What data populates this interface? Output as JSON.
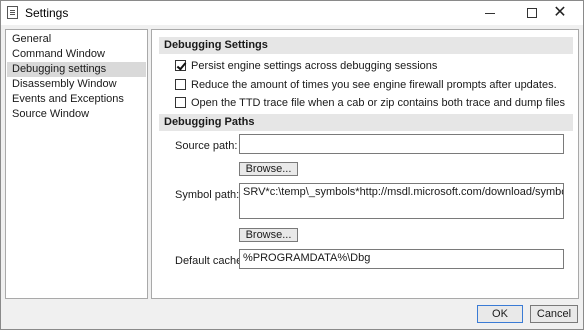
{
  "window": {
    "title": "Settings",
    "close_glyph": "✕",
    "icons": {
      "title": "document-icon",
      "minimize": "minimize-icon",
      "maximize": "maximize-icon",
      "close": "close-icon"
    }
  },
  "nav": {
    "items": [
      {
        "label": "General"
      },
      {
        "label": "Command Window"
      },
      {
        "label": "Debugging settings",
        "selected": true
      },
      {
        "label": "Disassembly Window"
      },
      {
        "label": "Events and Exceptions"
      },
      {
        "label": "Source Window"
      }
    ]
  },
  "debugging_settings": {
    "header": "Debugging Settings",
    "options": [
      {
        "label": "Persist engine settings across debugging sessions",
        "checked": true
      },
      {
        "label": "Reduce the amount of times you see engine firewall prompts after updates.",
        "checked": false
      },
      {
        "label": "Open the TTD trace file when a cab or zip contains both trace and dump files",
        "checked": false
      }
    ]
  },
  "debugging_paths": {
    "header": "Debugging Paths",
    "source_path": {
      "label": "Source path:",
      "value": "",
      "browse_label": "Browse..."
    },
    "symbol_path": {
      "label": "Symbol path:",
      "value": "SRV*c:\\temp\\_symbols*http://msdl.microsoft.com/download/symbols",
      "browse_label": "Browse..."
    },
    "default_cache": {
      "label": "Default cache:",
      "value": "%PROGRAMDATA%\\Dbg"
    }
  },
  "footer": {
    "ok_label": "OK",
    "cancel_label": "Cancel"
  },
  "colors": {
    "selected_nav": "#d9d9d9",
    "section_header": "#e6e6e6",
    "default_button_border": "#3a7bd5"
  }
}
